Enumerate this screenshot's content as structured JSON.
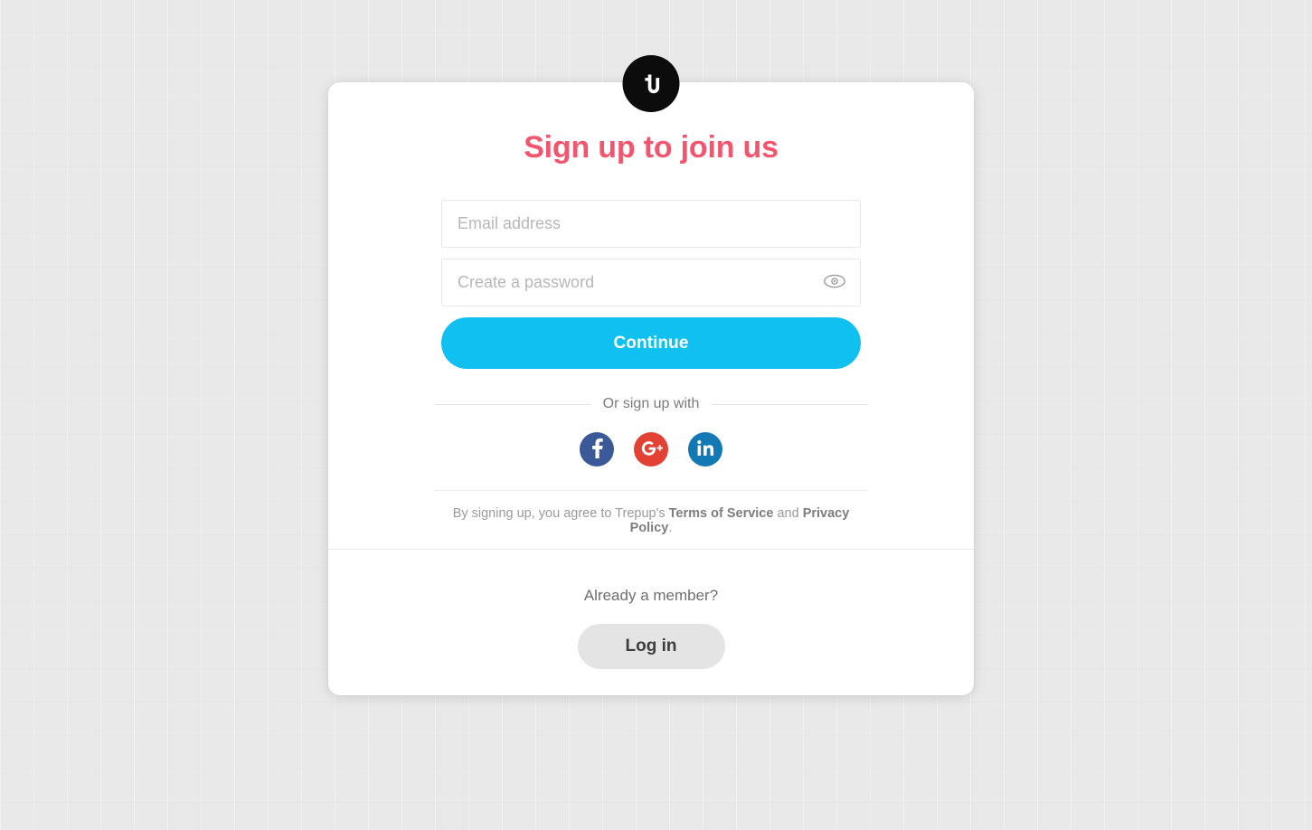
{
  "brand": {
    "name": "Trepup",
    "logo_icon": "trepup-tu-logo",
    "logo_bg": "#0c0c0c",
    "logo_fg": "#ffffff"
  },
  "colors": {
    "page_bg": "#e9e9e9",
    "card_bg": "#ffffff",
    "title": "#f2566e",
    "primary_button": "#0fc0f0",
    "primary_button_text": "#ffffff",
    "secondary_button": "#e4e4e4",
    "secondary_button_text": "#3d3d3d",
    "facebook": "#3b5998",
    "google_plus": "#e34133",
    "linkedin": "#1279b5",
    "input_border": "#e6e6e6",
    "placeholder": "#b7b7b7"
  },
  "signup": {
    "title": "Sign up to join us",
    "email": {
      "placeholder": "Email address",
      "value": ""
    },
    "password": {
      "placeholder": "Create a password",
      "value": "",
      "toggle_icon": "eye-icon"
    },
    "continue_label": "Continue",
    "divider_label": "Or sign up with",
    "social_buttons": [
      {
        "id": "facebook",
        "icon": "facebook-icon",
        "label": "f"
      },
      {
        "id": "google-plus",
        "icon": "google-plus-icon",
        "label": "G+"
      },
      {
        "id": "linkedin",
        "icon": "linkedin-icon",
        "label": "in"
      }
    ],
    "terms": {
      "prefix": "By signing up, you agree to Trepup's ",
      "terms_link": "Terms of Service",
      "conjunction": " and ",
      "privacy_link": "Privacy Policy",
      "suffix": "."
    }
  },
  "footer": {
    "member_prompt": "Already a member?",
    "login_label": "Log in"
  }
}
